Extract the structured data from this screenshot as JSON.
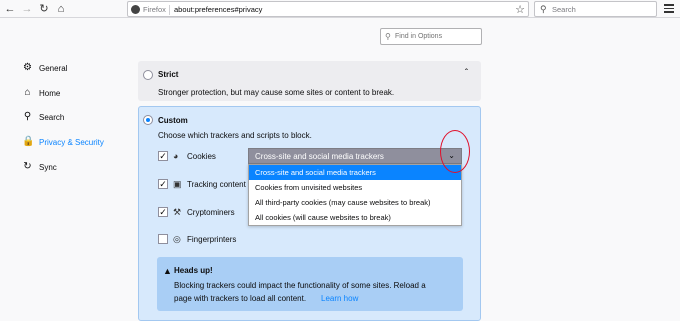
{
  "toolbar": {
    "identity_label": "Firefox",
    "url": "about:preferences#privacy",
    "search_placeholder": "Search"
  },
  "find": {
    "placeholder": "Find in Options"
  },
  "sidebar": {
    "items": [
      {
        "label": "General",
        "icon": "gear-icon"
      },
      {
        "label": "Home",
        "icon": "home-icon"
      },
      {
        "label": "Search",
        "icon": "search-icon"
      },
      {
        "label": "Privacy & Security",
        "icon": "lock-icon",
        "active": true
      },
      {
        "label": "Sync",
        "icon": "sync-icon"
      }
    ]
  },
  "strict": {
    "title": "Strict",
    "description": "Stronger protection, but may cause some sites or content to break."
  },
  "custom": {
    "title": "Custom",
    "description": "Choose which trackers and scripts to block.",
    "options": [
      {
        "label": "Cookies",
        "checked": true,
        "icon": "cookie-icon"
      },
      {
        "label": "Tracking content",
        "checked": true,
        "icon": "tracking-icon"
      },
      {
        "label": "Cryptominers",
        "checked": true,
        "icon": "cryptominer-icon"
      },
      {
        "label": "Fingerprinters",
        "checked": false,
        "icon": "fingerprint-icon"
      }
    ],
    "cookie_select": {
      "selected": "Cross-site and social media trackers",
      "options": [
        "Cross-site and social media trackers",
        "Cookies from unvisited websites",
        "All third-party cookies (may cause websites to break)",
        "All cookies (will cause websites to break)"
      ]
    },
    "headsup": {
      "title": "Heads up!",
      "line1": "Blocking trackers could impact the functionality of some sites. Reload a",
      "line2": "page with trackers to load all content.",
      "link": "Learn how"
    }
  },
  "colors": {
    "accent": "#0a84ff",
    "annotation": "#e0102b",
    "custom_bg": "#d7e9fc"
  }
}
